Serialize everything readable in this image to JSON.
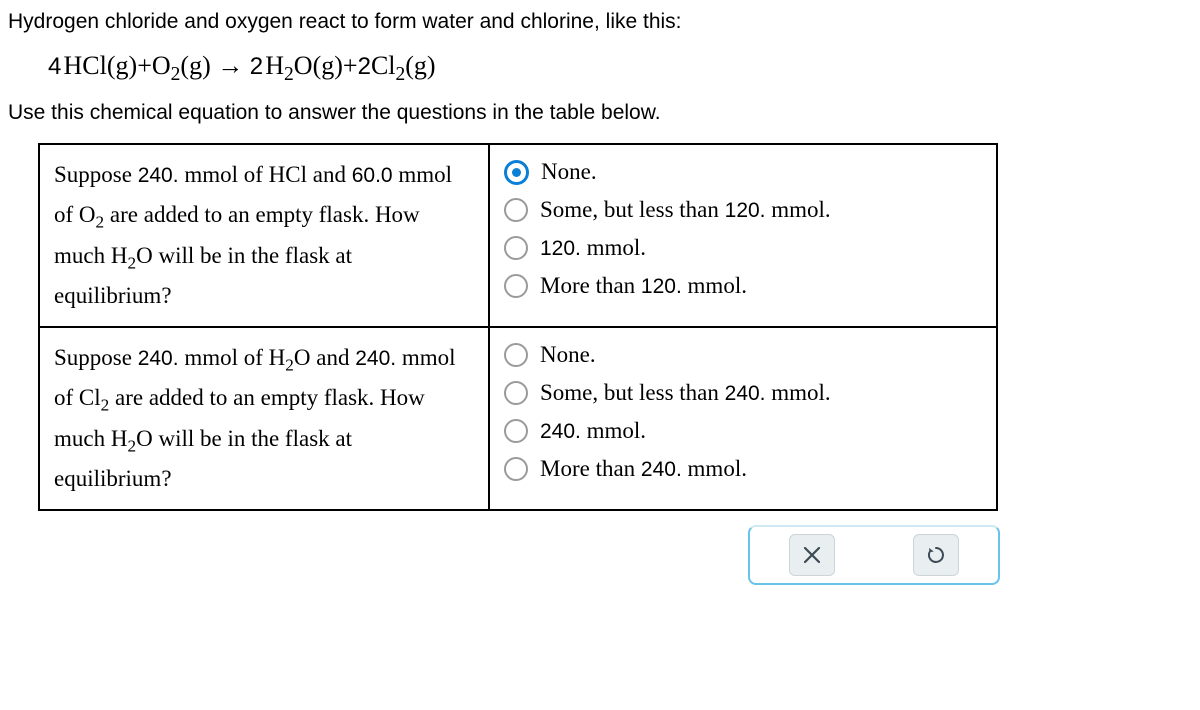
{
  "intro_line": "Hydrogen chloride and oxygen react to form water and chlorine, like this:",
  "equation": {
    "c1": "4",
    "r1": "HCl",
    "s1": "(g)",
    "plus1": "+",
    "r2": "O",
    "r2sub": "2",
    "s2": "(g)",
    "arrow": "→",
    "c3": "2",
    "r3": "H",
    "r3sub": "2",
    "r3b": "O",
    "s3": "(g)",
    "plus2": "+",
    "c4": "2",
    "r4": "Cl",
    "r4sub": "2",
    "s4": "(g)"
  },
  "instruction": "Use this chemical equation to answer the questions in the table below.",
  "rows": [
    {
      "question": {
        "p1": "Suppose ",
        "n1": "240.",
        "p2": " mmol of HCl and ",
        "n2": "60.0",
        "p3": " mmol of O",
        "sub1": "2",
        "p4": " are added to an empty flask. How much H",
        "sub2": "2",
        "p5": "O will be in the flask at equilibrium?"
      },
      "options": [
        {
          "pre": "None.",
          "num": "",
          "post": "",
          "selected": true
        },
        {
          "pre": "Some, but less than ",
          "num": "120.",
          "post": " mmol.",
          "selected": false
        },
        {
          "pre": "",
          "num": "120.",
          "post": " mmol.",
          "selected": false
        },
        {
          "pre": "More than ",
          "num": "120.",
          "post": " mmol.",
          "selected": false
        }
      ]
    },
    {
      "question": {
        "p1": "Suppose ",
        "n1": "240.",
        "p2": " mmol of H",
        "sub0": "2",
        "p2b": "O and ",
        "n2": "240.",
        "p3": " mmol of Cl",
        "sub1": "2",
        "p4": " are added to an empty flask. How much H",
        "sub2": "2",
        "p5": "O will be in the flask at equilibrium?"
      },
      "options": [
        {
          "pre": "None.",
          "num": "",
          "post": "",
          "selected": false
        },
        {
          "pre": "Some, but less than ",
          "num": "240.",
          "post": " mmol.",
          "selected": false
        },
        {
          "pre": "",
          "num": "240.",
          "post": " mmol.",
          "selected": false
        },
        {
          "pre": "More than ",
          "num": "240.",
          "post": " mmol.",
          "selected": false
        }
      ]
    }
  ],
  "toolbar": {
    "close": "close",
    "reset": "reset"
  }
}
